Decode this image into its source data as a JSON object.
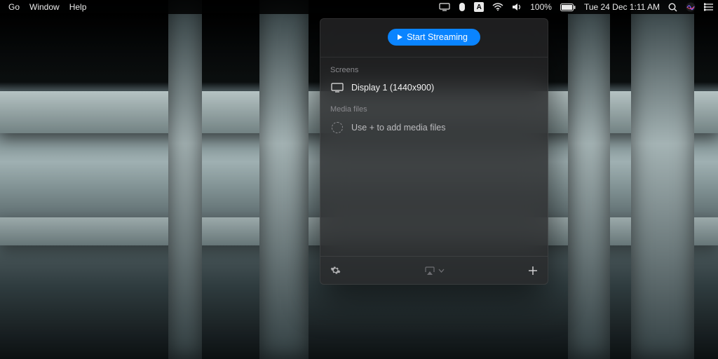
{
  "menubar": {
    "items": [
      "Go",
      "Window",
      "Help"
    ],
    "input_badge": "A",
    "battery_pct": "100%",
    "datetime": "Tue 24 Dec  1:11 AM"
  },
  "panel": {
    "start_button": "Start Streaming",
    "sections": {
      "screens": {
        "label": "Screens",
        "items": [
          "Display 1 (1440x900)"
        ]
      },
      "media": {
        "label": "Media files",
        "empty_hint": "Use + to add media files"
      }
    }
  }
}
